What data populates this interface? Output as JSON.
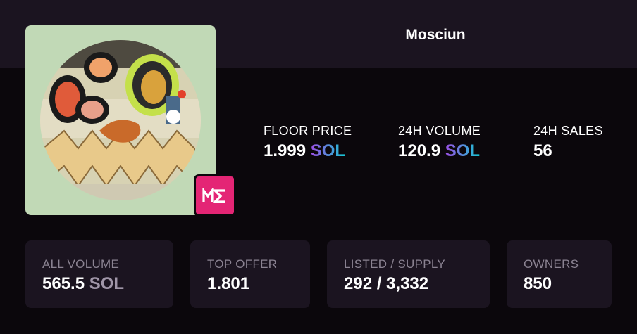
{
  "collection": {
    "title": "Mosciun"
  },
  "badge": {
    "icon": "magic-eden-logo-icon",
    "color": "#e42575"
  },
  "stats": {
    "floor_price": {
      "label": "FLOOR PRICE",
      "value": "1.999",
      "unit": "SOL"
    },
    "volume_24h": {
      "label": "24H VOLUME",
      "value": "120.9",
      "unit": "SOL"
    },
    "sales_24h": {
      "label": "24H SALES",
      "value": "56"
    }
  },
  "cards": {
    "all_volume": {
      "label": "ALL VOLUME",
      "value": "565.5",
      "unit": "SOL"
    },
    "top_offer": {
      "label": "TOP OFFER",
      "value": "1.801"
    },
    "listed_supply": {
      "label": "LISTED / SUPPLY",
      "value": "292 / 3,332"
    },
    "owners": {
      "label": "OWNERS",
      "value": "850"
    }
  },
  "colors": {
    "background": "#0b070c",
    "panel": "#1b1420",
    "sol_gradient_start": "#9d4ee6",
    "sol_gradient_end": "#14c8d3"
  }
}
